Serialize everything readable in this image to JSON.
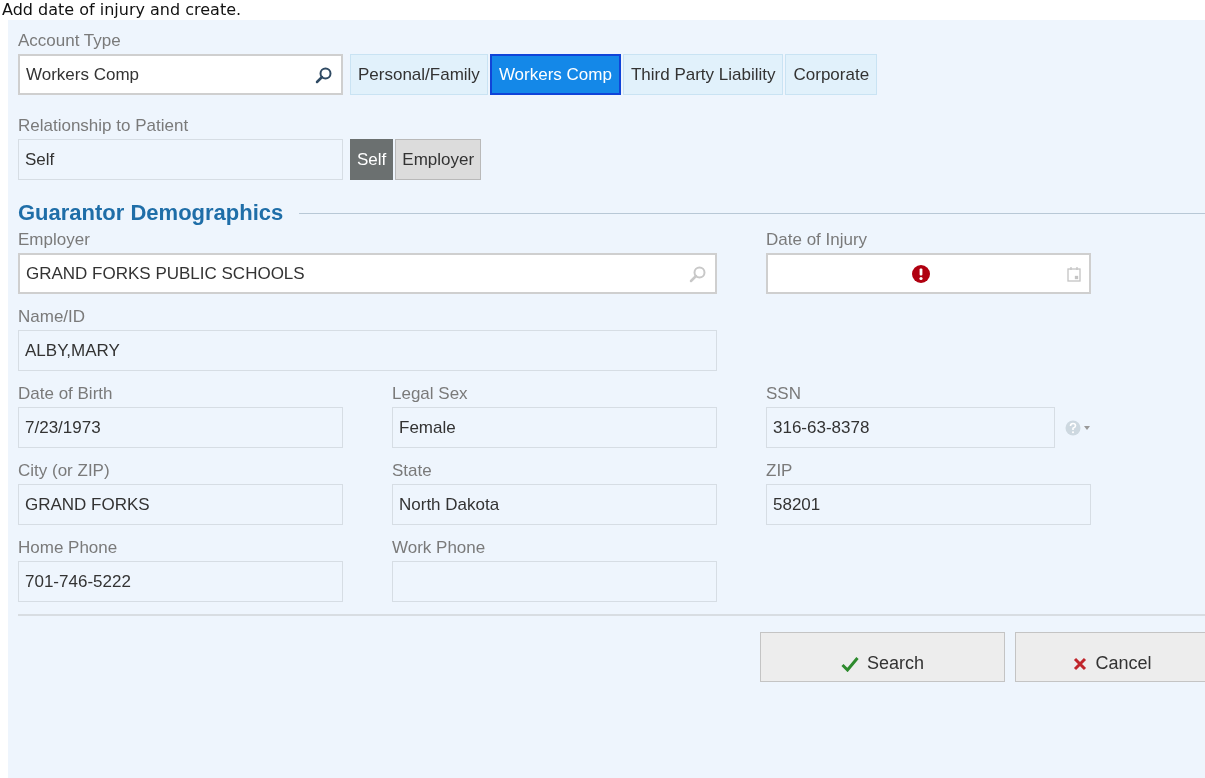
{
  "instruction": "Add date of injury and create.",
  "account_type": {
    "label": "Account Type",
    "value": "Workers Comp",
    "options": [
      {
        "label": "Personal/Family",
        "selected": false
      },
      {
        "label": "Workers Comp",
        "selected": true
      },
      {
        "label": "Third Party Liability",
        "selected": false
      },
      {
        "label": "Corporate",
        "selected": false
      }
    ]
  },
  "relationship": {
    "label": "Relationship to Patient",
    "value": "Self",
    "options": [
      {
        "label": "Self",
        "selected": true
      },
      {
        "label": "Employer",
        "selected": false
      }
    ]
  },
  "section_title": "Guarantor Demographics",
  "rows": [
    {
      "fields": [
        {
          "kind": "lookup",
          "label": "Employer",
          "value": "GRAND FORKS PUBLIC SCHOOLS"
        },
        {
          "kind": "date",
          "label": "Date of Injury",
          "error": true
        }
      ]
    },
    {
      "fields": [
        {
          "kind": "wide",
          "label": "Name/ID",
          "value": "ALBY,MARY"
        }
      ]
    },
    {
      "fields": [
        {
          "kind": "text",
          "label": "Date of Birth",
          "value": "7/23/1973"
        },
        {
          "kind": "text",
          "label": "Legal Sex",
          "value": "Female"
        },
        {
          "kind": "ssn",
          "label": "SSN",
          "value": "316-63-8378"
        }
      ]
    },
    {
      "fields": [
        {
          "kind": "text",
          "label": "City (or ZIP)",
          "value": "GRAND FORKS"
        },
        {
          "kind": "text",
          "label": "State",
          "value": "North Dakota"
        },
        {
          "kind": "text",
          "label": "ZIP",
          "value": "58201"
        }
      ]
    },
    {
      "fields": [
        {
          "kind": "text",
          "label": "Home Phone",
          "value": "701-746-5222"
        },
        {
          "kind": "text",
          "label": "Work Phone"
        }
      ]
    }
  ],
  "buttons": [
    {
      "kind": "confirm",
      "label": "Search"
    },
    {
      "kind": "cancel",
      "label": "Cancel"
    }
  ]
}
